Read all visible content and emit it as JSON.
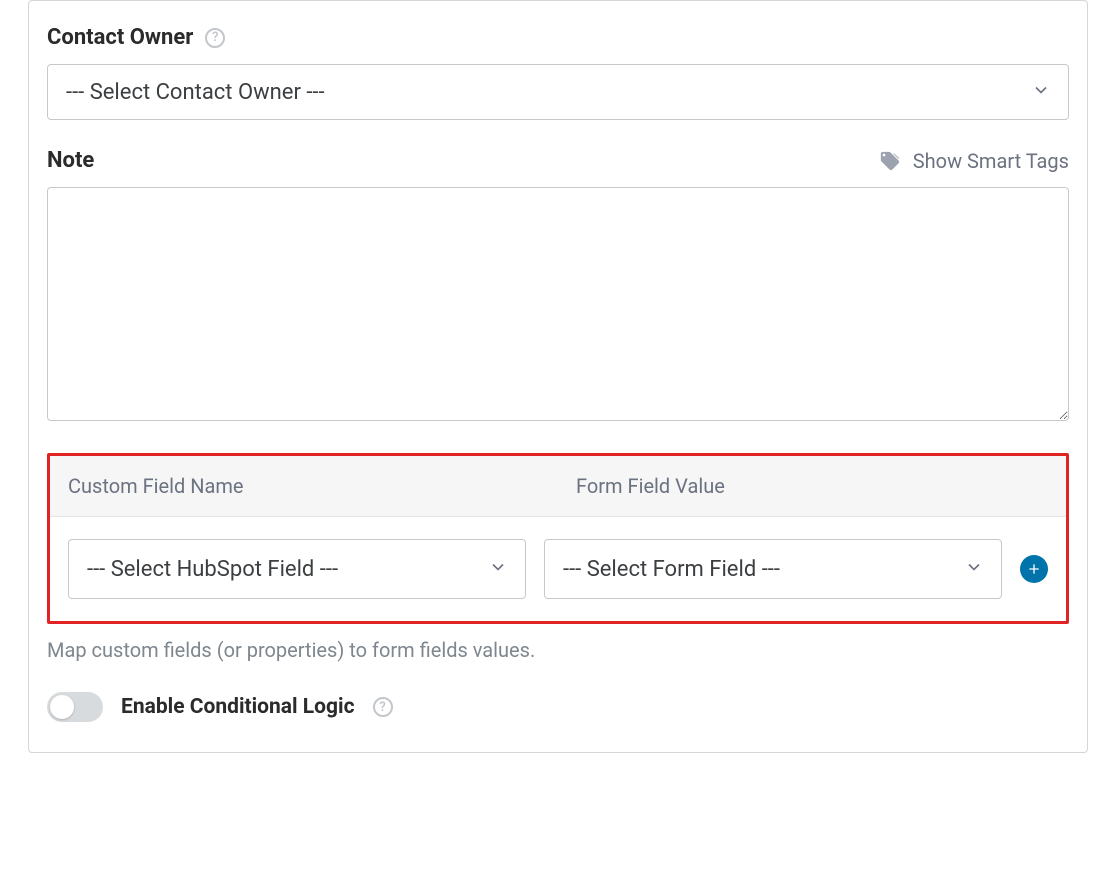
{
  "contactOwner": {
    "label": "Contact Owner",
    "placeholder": "--- Select Contact Owner ---"
  },
  "note": {
    "label": "Note",
    "smartTagsLabel": "Show Smart Tags",
    "value": ""
  },
  "mapping": {
    "header1": "Custom Field Name",
    "header2": "Form Field Value",
    "select1Placeholder": "--- Select HubSpot Field ---",
    "select2Placeholder": "--- Select Form Field ---",
    "helpText": "Map custom fields (or properties) to form fields values."
  },
  "conditional": {
    "label": "Enable Conditional Logic",
    "enabled": false
  }
}
